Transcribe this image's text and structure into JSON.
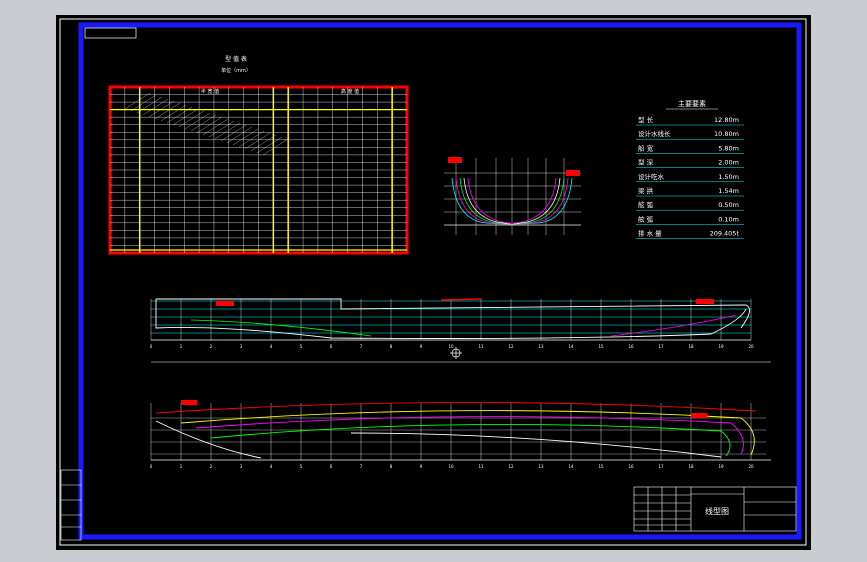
{
  "table": {
    "title": "型 值 表",
    "unit": "单位（mm）",
    "header_left": "半  宽  值",
    "header_right": "高  度  值"
  },
  "principal_dimensions": {
    "title": "主要要素",
    "rows": [
      {
        "label": "型  长",
        "value": "12.80m"
      },
      {
        "label": "设计水线长",
        "value": "10.80m"
      },
      {
        "label": "船  宽",
        "value": "5.80m"
      },
      {
        "label": "型  深",
        "value": "2.00m"
      },
      {
        "label": "设计吃水",
        "value": "1.50m"
      },
      {
        "label": "梁  拱",
        "value": "1.54m"
      },
      {
        "label": "舷  弧",
        "value": "0.50m"
      },
      {
        "label": "舷  弧",
        "value": "0.10m"
      },
      {
        "label": "排 水 量",
        "value": "209.405t"
      }
    ]
  },
  "title_block": {
    "drawing_name": "线型图"
  },
  "station_numbers": [
    "0",
    "1",
    "2",
    "3",
    "4",
    "5",
    "6",
    "7",
    "8",
    "9",
    "10",
    "11",
    "12",
    "13",
    "14",
    "15",
    "16",
    "17",
    "18",
    "19",
    "20"
  ],
  "colors": {
    "frame": "#1a1aff",
    "table_border": "#ff0000",
    "table_grid": "#ffff00",
    "lines": "#ffffff",
    "waterline_1": "#00ffff",
    "waterline_2": "#ff00ff",
    "waterline_3": "#00ff00",
    "annot": "#ff0000"
  }
}
